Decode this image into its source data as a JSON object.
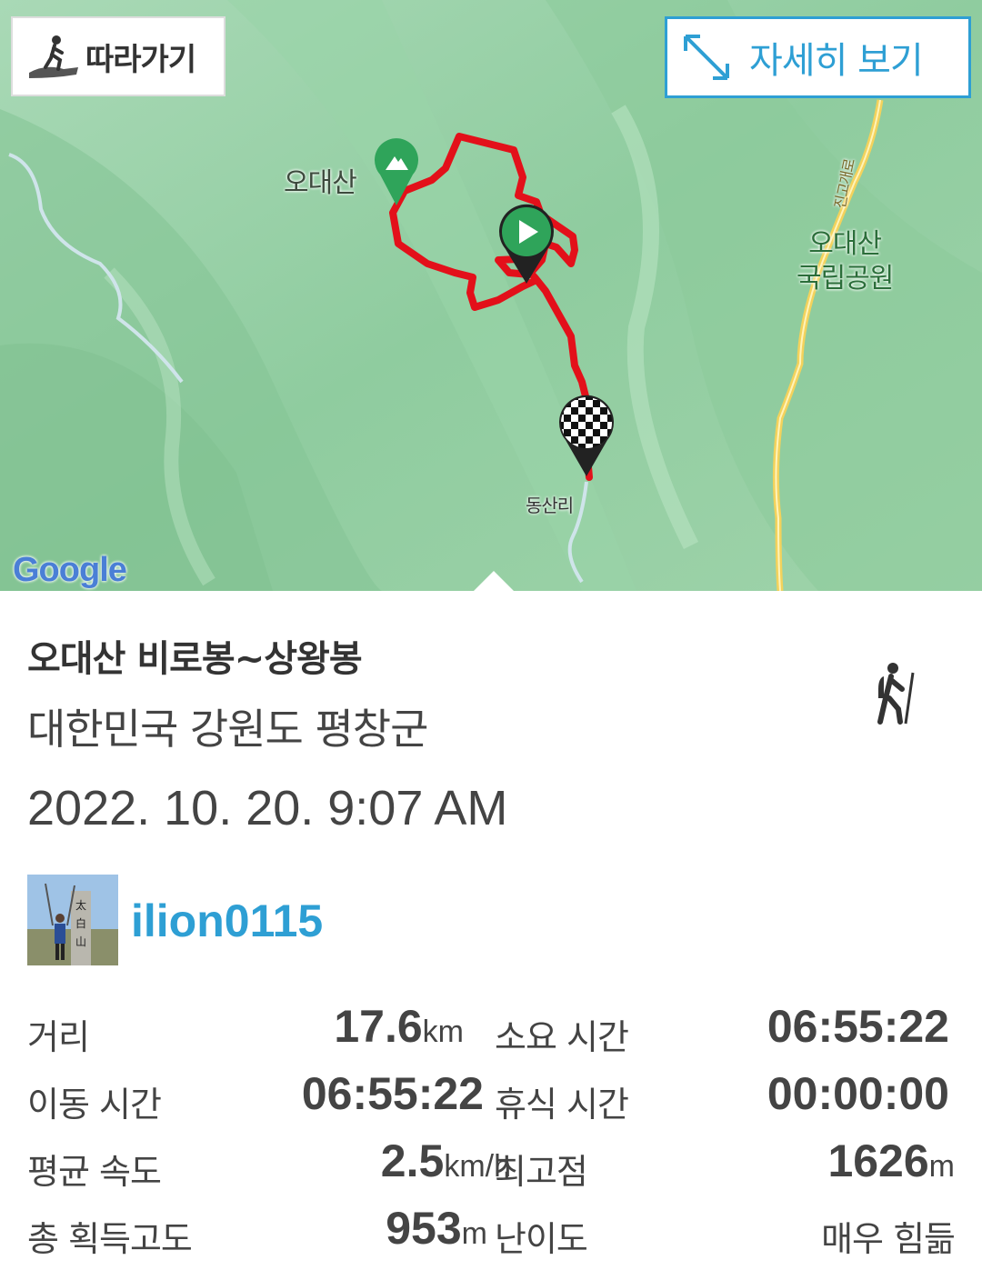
{
  "map": {
    "follow_label": "따라가기",
    "detail_label": "자세히 보기",
    "labels": {
      "peak": "오대산",
      "park_line1": "오대산",
      "park_line2": "국립공원",
      "village": "동산리",
      "road": "진고개로",
      "google": "Google"
    },
    "route_color": "#e3101a",
    "accent_color": "#2e9fd4"
  },
  "track": {
    "title": "오대산 비로봉~상왕봉",
    "location": "대한민국 강원도 평창군",
    "datetime": "2022. 10. 20. 9:07 AM",
    "username": "ilion0115",
    "activity_icon": "hiking-icon"
  },
  "stats": {
    "distance": {
      "label": "거리",
      "value": "17.6",
      "unit": "km"
    },
    "total_time": {
      "label": "소요 시간",
      "value": "06:55:22"
    },
    "moving_time": {
      "label": "이동 시간",
      "value": "06:55:22"
    },
    "rest_time": {
      "label": "휴식 시간",
      "value": "00:00:00"
    },
    "avg_speed": {
      "label": "평균 속도",
      "value": "2.5",
      "unit": "km/h"
    },
    "max_elevation": {
      "label": "최고점",
      "value": "1626",
      "unit": "m"
    },
    "elevation_gain": {
      "label": "총 획득고도",
      "value": "953",
      "unit": "m"
    },
    "difficulty": {
      "label": "난이도",
      "value": "매우 힘듦"
    }
  }
}
